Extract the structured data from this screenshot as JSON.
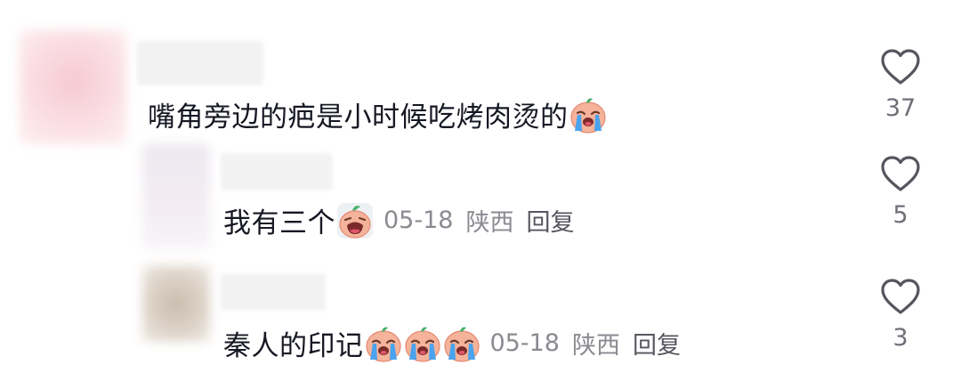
{
  "comments": [
    {
      "text": "嘴角旁边的疤是小时候吃烤肉烫的",
      "emoji_icons": [
        "crying-peach-emoji-icon"
      ],
      "like_count": "37"
    }
  ],
  "replies": [
    {
      "text": "我有三个",
      "emoji_icons": [
        "wailing-peach-emoji-icon"
      ],
      "date": "05-18",
      "location": "陕西",
      "reply_label": "回复",
      "like_count": "5"
    },
    {
      "text": "秦人的印记",
      "emoji_icons": [
        "crying-peach-emoji-icon",
        "crying-peach-emoji-icon",
        "crying-peach-emoji-icon"
      ],
      "date": "05-18",
      "location": "陕西",
      "reply_label": "回复",
      "like_count": "3"
    }
  ],
  "icons": {
    "like": "heart-outline-icon"
  },
  "colors": {
    "text": "#161823",
    "meta": "#8a8b91",
    "like_icon": "#55565e",
    "emoji_skin": "#f4b39a",
    "emoji_tears": "#4aa3ee"
  }
}
